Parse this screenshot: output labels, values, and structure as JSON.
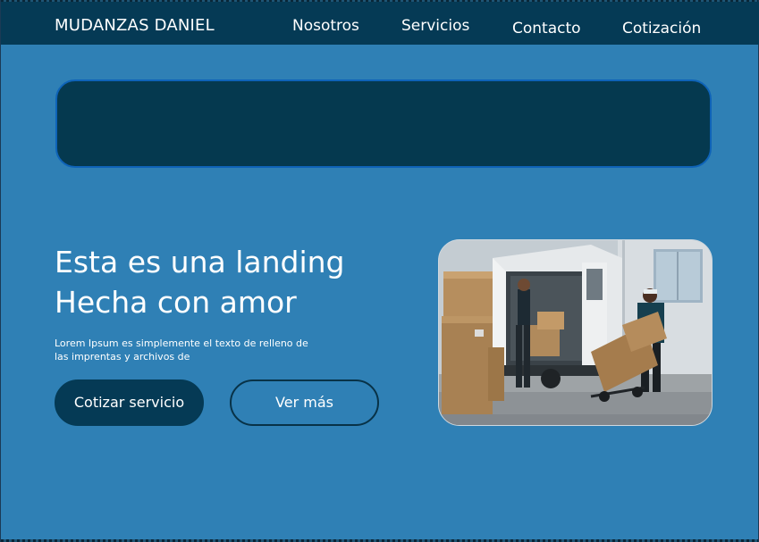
{
  "navbar": {
    "brand": "MUDANZAS DANIEL",
    "links": [
      {
        "label": "Nosotros"
      },
      {
        "label": "Servicios"
      },
      {
        "label": "Contacto"
      },
      {
        "label": "Cotización"
      }
    ]
  },
  "hero": {
    "title_line1": "Esta es una landing",
    "title_line2": "Hecha con amor",
    "description": "Lorem Ipsum es simplemente el texto de relleno de las imprentas y archivos de",
    "primary_button": "Cotizar servicio",
    "secondary_button": "Ver más"
  },
  "colors": {
    "background": "#2f80b5",
    "navbar": "#053a55",
    "banner": "#05394f",
    "banner_border": "#0e63b8"
  }
}
